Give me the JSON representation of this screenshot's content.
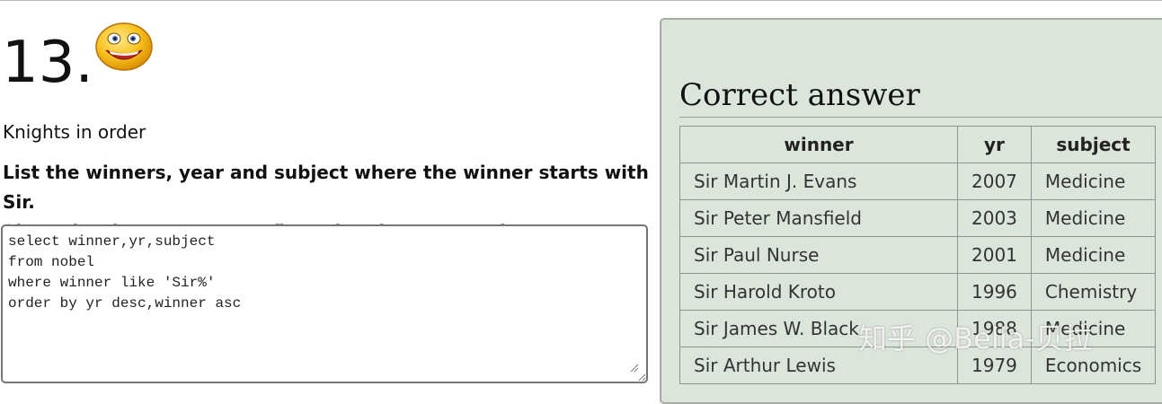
{
  "question": {
    "number": "13.",
    "title": "Knights in order",
    "description_line1": "List the winners, year and subject where the winner starts with Sir.",
    "description_line2": "Show the the most recent first, then by name order."
  },
  "editor": {
    "sql": "select winner,yr,subject\nfrom nobel\nwhere winner like 'Sir%'\norder by yr desc,winner asc"
  },
  "answer": {
    "heading": "Correct answer",
    "columns": [
      "winner",
      "yr",
      "subject"
    ],
    "rows": [
      [
        "Sir Martin J. Evans",
        "2007",
        "Medicine"
      ],
      [
        "Sir Peter Mansfield",
        "2003",
        "Medicine"
      ],
      [
        "Sir Paul Nurse",
        "2001",
        "Medicine"
      ],
      [
        "Sir Harold Kroto",
        "1996",
        "Chemistry"
      ],
      [
        "Sir James W. Black",
        "1988",
        "Medicine"
      ],
      [
        "Sir Arthur Lewis",
        "1979",
        "Economics"
      ]
    ]
  },
  "watermark": "知乎 @Bella-贝拉",
  "colors": {
    "panel_background": "#dce5db",
    "panel_border": "#a7aaa6",
    "table_border": "#8e938d"
  },
  "icons": {
    "smiley": "smiley-face-icon"
  }
}
